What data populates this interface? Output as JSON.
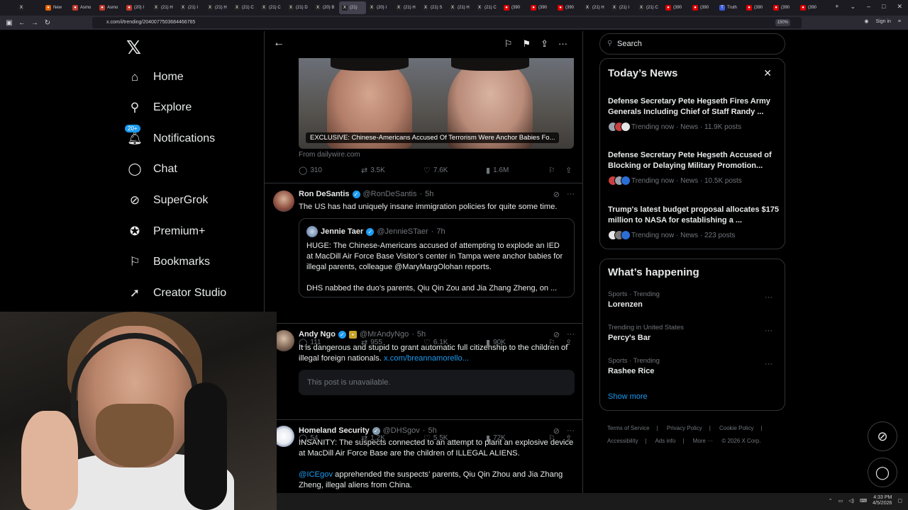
{
  "browser": {
    "tabs": [
      {
        "label": "",
        "icon": "x-logo"
      },
      {
        "label": "New",
        "icon": "firefox"
      },
      {
        "label": "Asmo",
        "icon": "asmon"
      },
      {
        "label": "Asmo",
        "icon": "asmon"
      },
      {
        "label": "(20) I",
        "icon": "asmon"
      },
      {
        "label": "(21) H",
        "icon": "x-logo"
      },
      {
        "label": "(21) I",
        "icon": "x-logo"
      },
      {
        "label": "(21) H",
        "icon": "x-logo"
      },
      {
        "label": "(21) C",
        "icon": "x-logo"
      },
      {
        "label": "(21) C",
        "icon": "x-logo"
      },
      {
        "label": "(21) D",
        "icon": "x-logo"
      },
      {
        "label": "(20) B",
        "icon": "x-logo"
      },
      {
        "label": "(21)",
        "icon": "x-logo",
        "active": true
      },
      {
        "label": "(20) I",
        "icon": "x-logo"
      },
      {
        "label": "(21) H",
        "icon": "x-logo"
      },
      {
        "label": "(21) S",
        "icon": "x-logo"
      },
      {
        "label": "(21) H",
        "icon": "x-logo"
      },
      {
        "label": "(21) C",
        "icon": "x-logo"
      },
      {
        "label": "(390",
        "icon": "yt"
      },
      {
        "label": "(390",
        "icon": "yt"
      },
      {
        "label": "(390",
        "icon": "yt"
      },
      {
        "label": "(21) H",
        "icon": "x-logo"
      },
      {
        "label": "(21) I",
        "icon": "x-logo"
      },
      {
        "label": "(21) C",
        "icon": "x-logo"
      },
      {
        "label": "(390",
        "icon": "yt"
      },
      {
        "label": "(390",
        "icon": "yt"
      },
      {
        "label": "Truth",
        "icon": "truth"
      },
      {
        "label": "(390",
        "icon": "yt"
      },
      {
        "label": "(390",
        "icon": "yt"
      },
      {
        "label": "(390",
        "icon": "yt"
      }
    ],
    "url": "x.com/i/trending/2040077503684466765",
    "zoom": "150%",
    "sign_in": "Sign in"
  },
  "sidebar": {
    "items": [
      {
        "label": "Home",
        "icon": "home-icon"
      },
      {
        "label": "Explore",
        "icon": "search-icon"
      },
      {
        "label": "Notifications",
        "icon": "bell-icon",
        "badge": "20+"
      },
      {
        "label": "Chat",
        "icon": "chat-icon"
      },
      {
        "label": "SuperGrok",
        "icon": "grok-icon"
      },
      {
        "label": "Premium+",
        "icon": "premium-icon"
      },
      {
        "label": "Bookmarks",
        "icon": "bookmark-icon"
      },
      {
        "label": "Creator Studio",
        "icon": "rocket-icon"
      }
    ]
  },
  "main": {
    "first_post": {
      "media_caption": "EXCLUSIVE: Chinese-Americans Accused Of Terrorism Were Anchor Babies Fo...",
      "from": "From dailywire.com",
      "replies": "310",
      "reposts": "3.5K",
      "likes": "7.6K",
      "views": "1.6M"
    },
    "posts": [
      {
        "name": "Ron DeSantis",
        "handle": "@RonDeSantis",
        "time": "5h",
        "text": "The US has had uniquely insane immigration policies for quite some time.",
        "quote": {
          "name": "Jennie Taer",
          "handle": "@JennieSTaer",
          "time": "7h",
          "text1": "HUGE: The Chinese-Americans accused of attempting to explode an IED at MacDill Air Force Base Visitor’s center in Tampa were anchor babies for illegal parents, colleague @MaryMargOlohan reports.",
          "text2": "DHS nabbed the duo’s parents, Qiu Qin Zou and Jia Zhang Zheng, on ..."
        },
        "replies": "111",
        "reposts": "955",
        "likes": "6.1K",
        "views": "90K"
      },
      {
        "name": "Andy Ngo",
        "handle": "@MrAndyNgo",
        "time": "5h",
        "text": "It is dangerous and stupid to grant automatic full citizenship to the children of illegal foreign nationals.",
        "link": "x.com/breannamorello...",
        "unavailable": "This post is unavailable.",
        "replies": "54",
        "reposts": "1.2K",
        "likes": "5.5K",
        "views": "72K"
      },
      {
        "name": "Homeland Security",
        "handle": "@DHSgov",
        "time": "5h",
        "text": "INSANITY: The suspects connected to an attempt to plant an explosive device at MacDill Air Force Base are the children of ILLEGAL ALIENS.",
        "mention": "@ICEgov",
        "text2": "apprehended the suspects’ parents, Qiu Qin Zhou and Jia Zhang Zheng, illegal aliens from China."
      }
    ]
  },
  "right": {
    "search_placeholder": "Search",
    "todays_news": {
      "title": "Today’s News",
      "items": [
        {
          "title": "Defense Secretary Pete Hegseth Fires Army Generals Including Chief of Staff Randy ...",
          "meta": "Trending now · News · 11.9K posts"
        },
        {
          "title": "Defense Secretary Pete Hegseth Accused of Blocking or Delaying Military Promotion...",
          "meta": "Trending now · News · 10.5K posts"
        },
        {
          "title": "Trump's latest budget proposal allocates $175 million to NASA for establishing a ...",
          "meta": "Trending now · News · 223 posts"
        }
      ]
    },
    "whats_happening": {
      "title": "What’s happening",
      "items": [
        {
          "category": "Sports · Trending",
          "name": "Lorenzen"
        },
        {
          "category": "Trending in United States",
          "name": "Percy's Bar"
        },
        {
          "category": "Sports · Trending",
          "name": "Rashee Rice"
        }
      ],
      "show_more": "Show more"
    },
    "footer": [
      "Terms of Service",
      "Privacy Policy",
      "Cookie Policy",
      "Accessibility",
      "Ads info",
      "More ···",
      "© 2026 X Corp."
    ]
  },
  "taskbar": {
    "time": "4:33 PM",
    "date": "4/5/2026"
  },
  "colors": {
    "accent": "#1d9bf0",
    "background": "#000000",
    "muted": "#71767b",
    "border": "#2f3336"
  }
}
